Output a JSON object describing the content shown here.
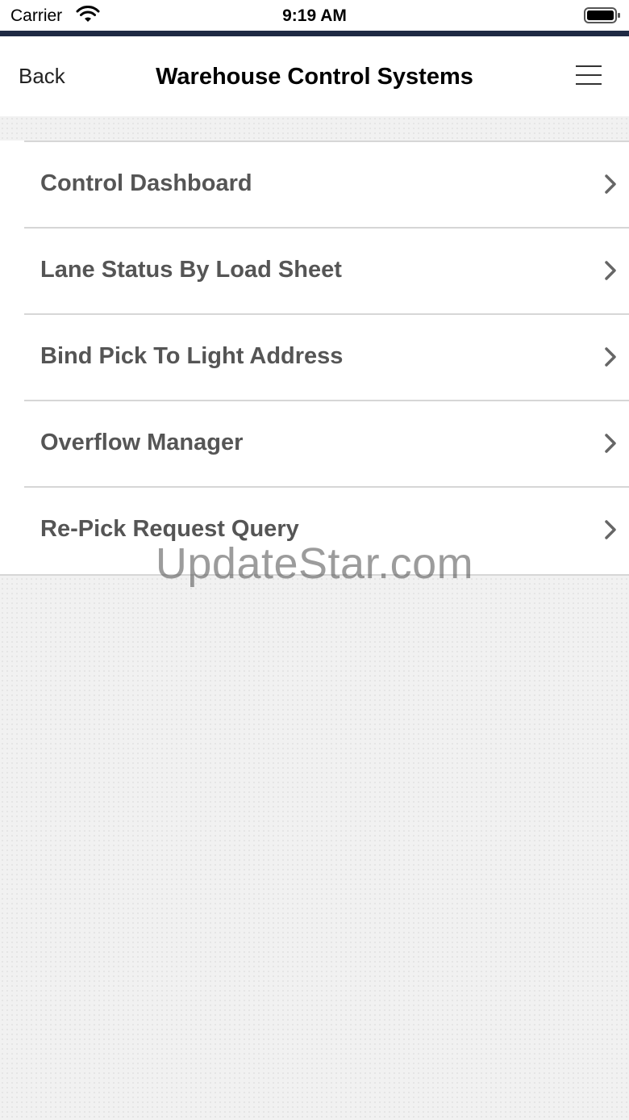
{
  "status_bar": {
    "carrier": "Carrier",
    "time": "9:19 AM"
  },
  "colors": {
    "accent": "#1f2a44",
    "item_text": "#555555",
    "background": "#f1f1f1"
  },
  "nav": {
    "back_label": "Back",
    "title": "Warehouse Control Systems",
    "menu_icon": "hamburger-menu-icon"
  },
  "menu": {
    "items": [
      {
        "label": "Control Dashboard",
        "icon": "chevron-right-icon"
      },
      {
        "label": "Lane Status By Load Sheet",
        "icon": "chevron-right-icon"
      },
      {
        "label": "Bind Pick To Light Address",
        "icon": "chevron-right-icon"
      },
      {
        "label": "Overflow Manager",
        "icon": "chevron-right-icon"
      },
      {
        "label": "Re-Pick Request Query",
        "icon": "chevron-right-icon"
      }
    ]
  },
  "watermark": "UpdateStar.com"
}
